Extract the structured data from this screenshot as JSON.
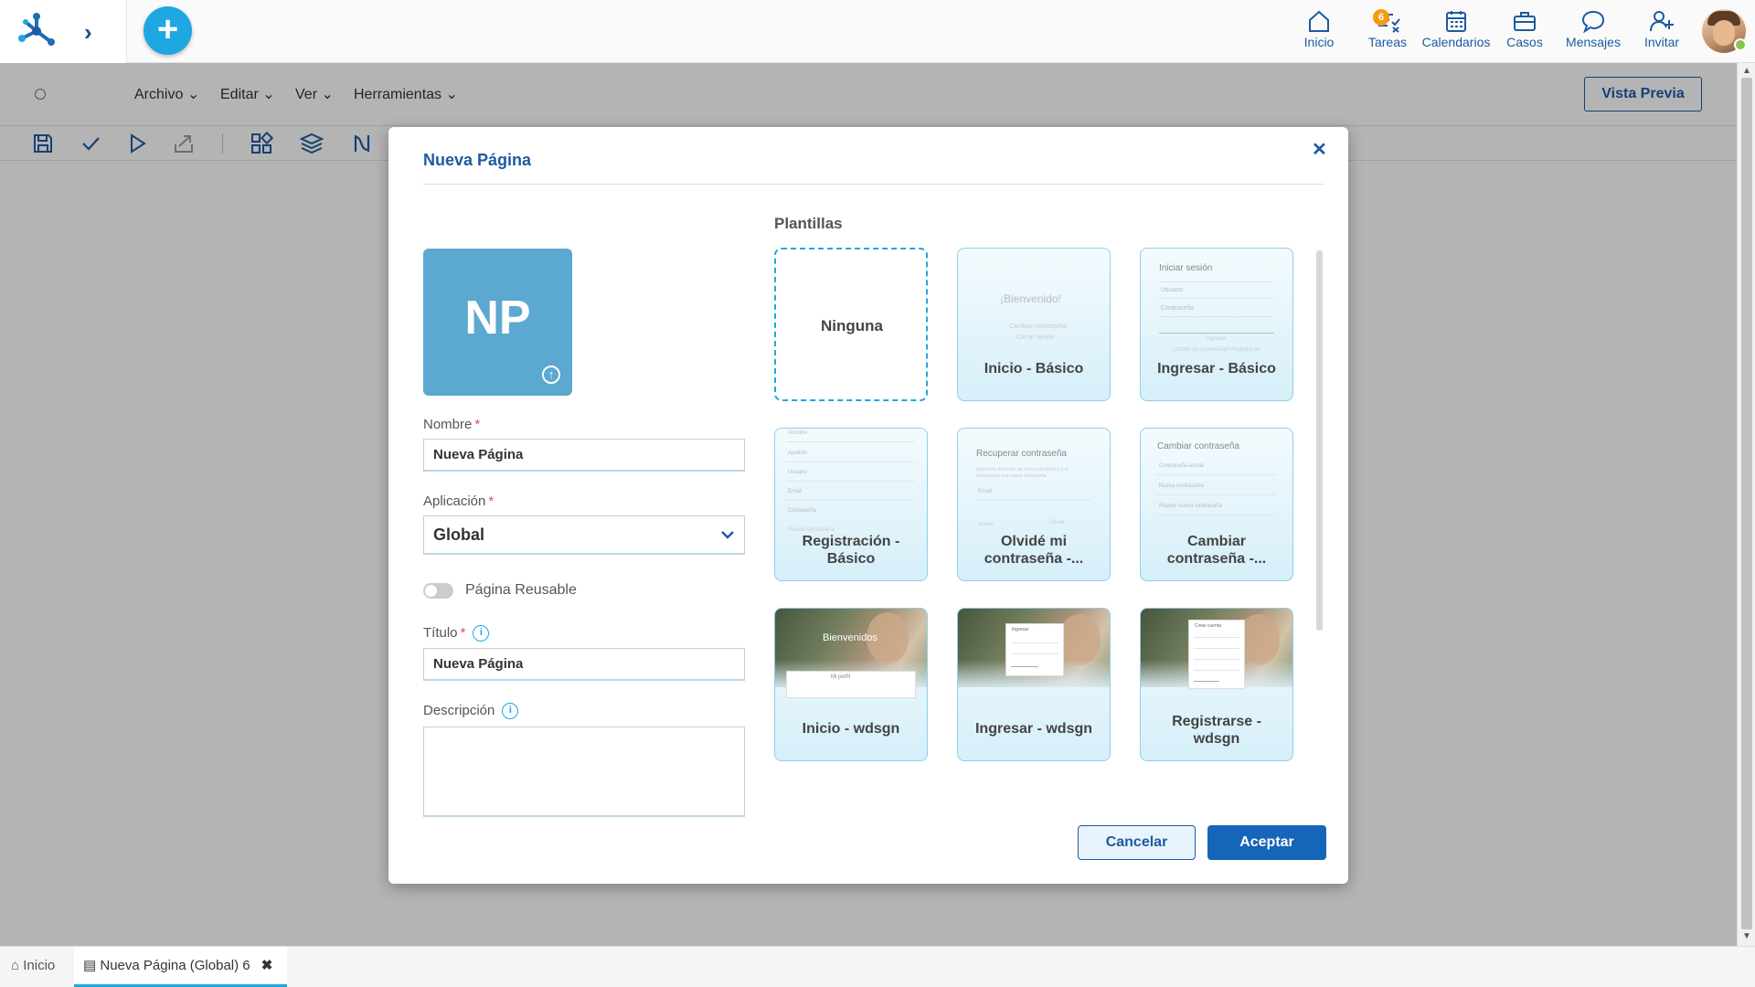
{
  "topnav": {
    "items": [
      {
        "label": "Inicio",
        "icon": "home-icon"
      },
      {
        "label": "Tareas",
        "icon": "tasks-icon",
        "badge": "6"
      },
      {
        "label": "Calendarios",
        "icon": "calendar-icon"
      },
      {
        "label": "Casos",
        "icon": "briefcase-icon"
      },
      {
        "label": "Mensajes",
        "icon": "chat-icon"
      },
      {
        "label": "Invitar",
        "icon": "invite-user-icon"
      }
    ]
  },
  "menubar": {
    "items": [
      "Archivo",
      "Editar",
      "Ver",
      "Herramientas"
    ],
    "preview_label": "Vista Previa"
  },
  "toolbar": {
    "icons": [
      "save-icon",
      "check-icon",
      "play-icon",
      "export-icon",
      "components-icon",
      "layers-icon",
      "flow-icon"
    ]
  },
  "modal": {
    "title": "Nueva Página",
    "avatar_initials": "NP",
    "fields": {
      "nombre_label": "Nombre",
      "nombre_value": "Nueva Página",
      "aplicacion_label": "Aplicación",
      "aplicacion_value": "Global",
      "reusable_label": "Página Reusable",
      "titulo_label": "Título",
      "titulo_value": "Nueva Página",
      "descripcion_label": "Descripción"
    },
    "templates_title": "Plantillas",
    "templates": [
      {
        "label": "Ninguna"
      },
      {
        "label": "Inicio - Básico",
        "preview_heading": "¡Bienvenido!",
        "preview_lines": [
          "Cambiar contraseña",
          "Cerrar sesión"
        ]
      },
      {
        "label": "Ingresar - Básico",
        "preview_heading": "Iniciar sesión",
        "preview_lines": [
          "Usuario",
          "Contraseña",
          "Ingresar",
          "¿Olvidó su contraseña? Registrarse"
        ]
      },
      {
        "label": "Registración - Básico",
        "preview_lines": [
          "Nombre",
          "Apellido",
          "Usuario",
          "Email",
          "Contraseña",
          "Repetir contraseña"
        ]
      },
      {
        "label": "Olvidé mi contraseña -...",
        "preview_heading": "Recuperar contraseña",
        "preview_lines": [
          "Ingrese la dirección de correo electrónico y le enviaremos una nueva contraseña",
          "Email",
          "Volver",
          "Enviar"
        ]
      },
      {
        "label": "Cambiar contraseña -...",
        "preview_heading": "Cambiar contraseña",
        "preview_lines": [
          "Contraseña actual",
          "Nueva contraseña",
          "Repetir nueva contraseña"
        ]
      },
      {
        "label": "Inicio - wdsgn",
        "preview_heading": "Bienvenidos",
        "preview_lines": [
          "Mi perfil"
        ]
      },
      {
        "label": "Ingresar - wdsgn",
        "preview_heading": "Ingresar"
      },
      {
        "label": "Registrarse - wdsgn",
        "preview_heading": "Crear cuenta"
      }
    ],
    "cancel_label": "Cancelar",
    "accept_label": "Aceptar"
  },
  "footer": {
    "tabs": [
      {
        "label": "Inicio"
      },
      {
        "label": "Nueva Página (Global) 6"
      }
    ]
  },
  "colors": {
    "primary": "#1e5aa0",
    "accent": "#1ea7e1",
    "badge": "#f39c12",
    "tile": "#5ba8d0",
    "online": "#8bc34a"
  }
}
